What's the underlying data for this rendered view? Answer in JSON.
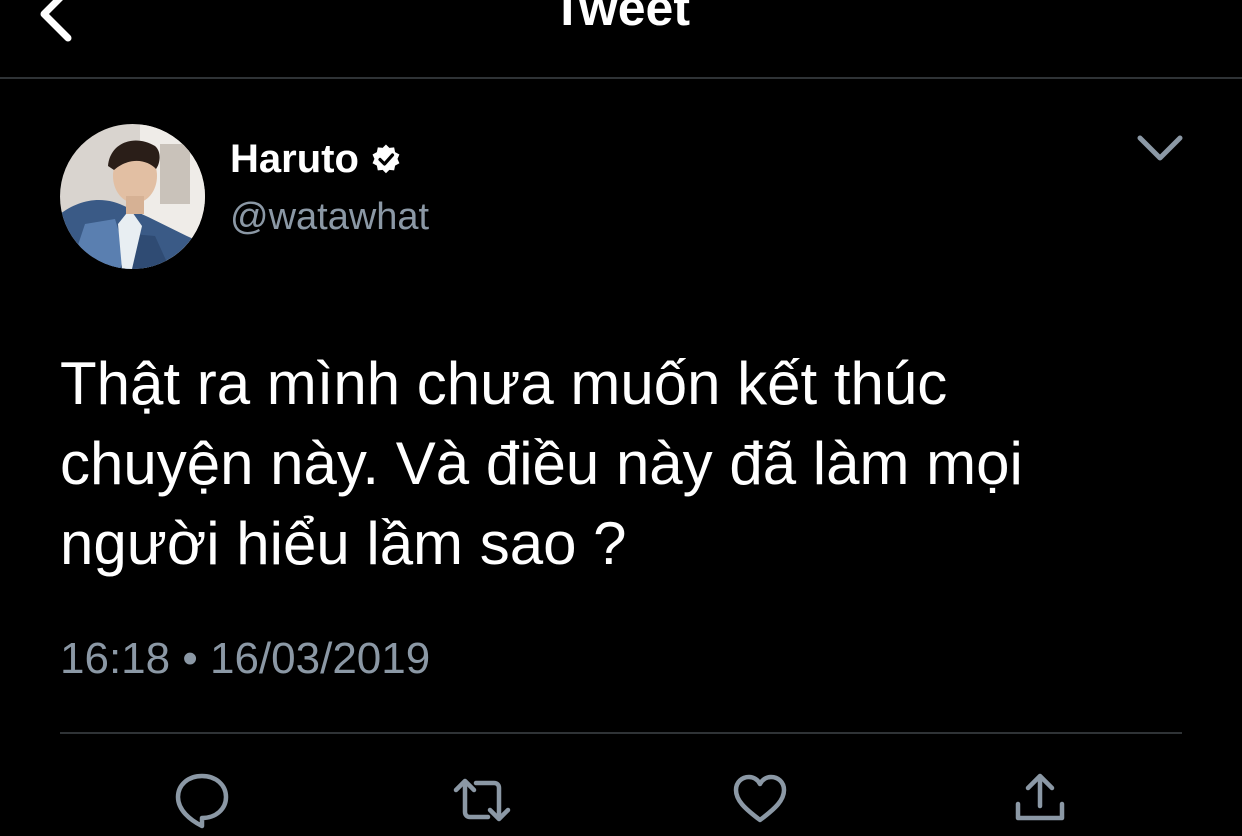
{
  "header": {
    "title": "Tweet"
  },
  "tweet": {
    "author": {
      "display_name": "Haruto",
      "handle": "@watawhat",
      "verified": true
    },
    "text": "Thật ra mình chưa muốn kết thúc\nchuyện này. Và điều này đã làm mọi\nngười hiểu lầm sao ?",
    "time": "16:18",
    "separator": "•",
    "date": "16/03/2019"
  },
  "actions": [
    {
      "icon": "reply-icon"
    },
    {
      "icon": "retweet-icon"
    },
    {
      "icon": "like-icon"
    },
    {
      "icon": "share-icon"
    }
  ],
  "colors": {
    "background": "#000000",
    "text_primary": "#ffffff",
    "text_secondary": "#8b98a5",
    "divider": "#2f3336",
    "icon": "#8b98a5"
  }
}
